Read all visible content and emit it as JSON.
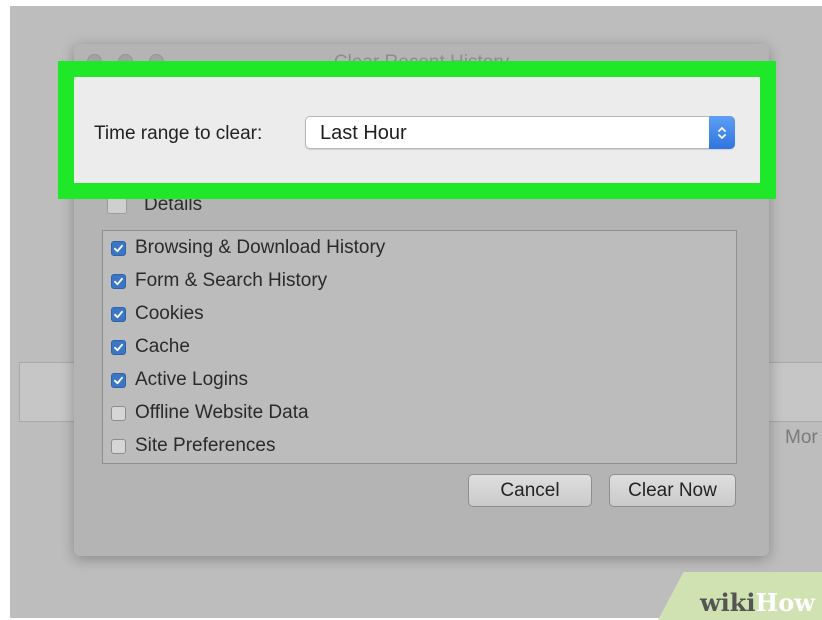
{
  "dialog": {
    "title": "Clear Recent History",
    "time_range_label": "Time range to clear:",
    "time_range_value": "Last Hour",
    "details_label": "Details",
    "items": [
      {
        "label": "Browsing & Download History",
        "checked": true
      },
      {
        "label": "Form & Search History",
        "checked": true
      },
      {
        "label": "Cookies",
        "checked": true
      },
      {
        "label": "Cache",
        "checked": true
      },
      {
        "label": "Active Logins",
        "checked": true
      },
      {
        "label": "Offline Website Data",
        "checked": false
      },
      {
        "label": "Site Preferences",
        "checked": false
      }
    ],
    "cancel_label": "Cancel",
    "clear_now_label": "Clear Now"
  },
  "background": {
    "more_label": "Mor"
  },
  "watermark": {
    "part1": "wiki",
    "part2": "How"
  },
  "colors": {
    "highlight": "#1ee828",
    "checkbox_checked": "#3b76c5",
    "select_arrow": "#2f74e0"
  },
  "icons": {
    "checkbox": "checkmark-icon",
    "select": "up-down-chevron-icon"
  }
}
